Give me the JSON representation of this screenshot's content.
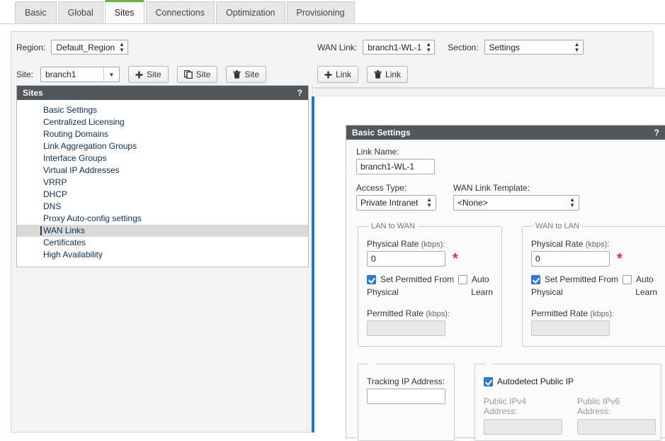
{
  "tabs": [
    {
      "label": "Basic",
      "active": false
    },
    {
      "label": "Global",
      "active": false
    },
    {
      "label": "Sites",
      "active": true
    },
    {
      "label": "Connections",
      "active": false
    },
    {
      "label": "Optimization",
      "active": false
    },
    {
      "label": "Provisioning",
      "active": false
    }
  ],
  "left": {
    "region_label": "Region:",
    "region_value": "Default_Region",
    "site_label": "Site:",
    "site_value": "branch1",
    "add_site_button": "Site",
    "clone_site_button": "Site",
    "delete_site_button": "Site",
    "sites_panel": {
      "title": "Sites",
      "help": "?",
      "items": [
        {
          "label": "Basic Settings",
          "selected": false
        },
        {
          "label": "Centralized Licensing",
          "selected": false
        },
        {
          "label": "Routing Domains",
          "selected": false
        },
        {
          "label": "Link Aggregation Groups",
          "selected": false
        },
        {
          "label": "Interface Groups",
          "selected": false
        },
        {
          "label": "Virtual IP Addresses",
          "selected": false
        },
        {
          "label": "VRRP",
          "selected": false
        },
        {
          "label": "DHCP",
          "selected": false
        },
        {
          "label": "DNS",
          "selected": false
        },
        {
          "label": "Proxy Auto-config settings",
          "selected": false
        },
        {
          "label": "WAN Links",
          "selected": true
        },
        {
          "label": "Certificates",
          "selected": false
        },
        {
          "label": "High Availability",
          "selected": false
        }
      ]
    }
  },
  "right": {
    "wan_link_label": "WAN Link:",
    "wan_link_value": "branch1-WL-1",
    "section_label": "Section:",
    "section_value": "Settings",
    "add_link_button": "Link",
    "delete_link_button": "Link"
  },
  "card": {
    "title": "Basic Settings",
    "help": "?",
    "link_name_label": "Link Name:",
    "link_name_value": "branch1-WL-1",
    "access_type_label": "Access Type:",
    "access_type_value": "Private Intranet",
    "wan_template_label": "WAN Link Template:",
    "wan_template_value": "<None>",
    "lan_to_wan": {
      "legend": "LAN to WAN",
      "physical_rate_label": "Physical Rate",
      "physical_rate_units": "(kbps):",
      "physical_rate_value": "0",
      "required_marker": "*",
      "set_permitted_label": "Set Permitted From",
      "set_permitted_label2": "Physical",
      "auto_label": "Auto",
      "auto_label2": "Learn",
      "permitted_rate_label": "Permitted Rate",
      "permitted_rate_units": "(kbps):",
      "permitted_rate_value": ""
    },
    "wan_to_lan": {
      "legend": "WAN to LAN",
      "physical_rate_label": "Physical Rate",
      "physical_rate_units": "(kbps):",
      "physical_rate_value": "0",
      "required_marker": "*",
      "set_permitted_label": "Set Permitted From",
      "set_permitted_label2": "Physical",
      "auto_label": "Auto",
      "auto_label2": "Learn",
      "permitted_rate_label": "Permitted Rate",
      "permitted_rate_units": "(kbps):",
      "permitted_rate_value": ""
    },
    "tracking": {
      "tracking_ip_label": "Tracking IP Address:",
      "tracking_ip_value": "",
      "autodetect_label": "Autodetect Public IP",
      "public_ipv4_label": "Public IPv4",
      "public_ipv4_label2": "Address:",
      "public_ipv4_value": "",
      "public_ipv6_label": "Public IPv6",
      "public_ipv6_label2": "Address:",
      "public_ipv6_value": ""
    }
  },
  "colors": {
    "accent_tab": "#6db33f",
    "panel_header": "#53565a",
    "blue_divider": "#1f7bc1",
    "checkbox_on": "#2f7fd0",
    "required_red": "#e8312f",
    "link_text": "#0b2e59"
  }
}
